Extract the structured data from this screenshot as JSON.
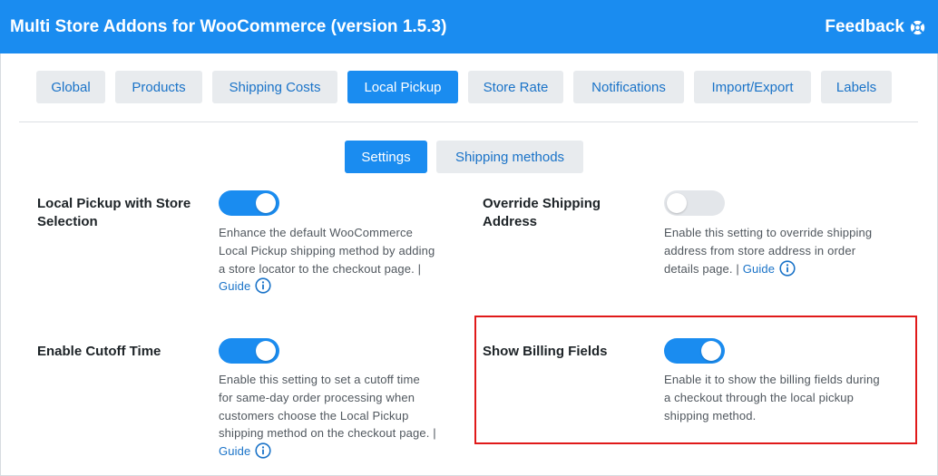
{
  "header": {
    "title": "Multi Store Addons for WooCommerce (version 1.5.3)",
    "feedback_label": "Feedback"
  },
  "tabs": [
    {
      "label": "Global"
    },
    {
      "label": "Products"
    },
    {
      "label": "Shipping Costs"
    },
    {
      "label": "Local Pickup",
      "active": true
    },
    {
      "label": "Store Rate"
    },
    {
      "label": "Notifications"
    },
    {
      "label": "Import/Export"
    },
    {
      "label": "Labels"
    }
  ],
  "subtabs": [
    {
      "label": "Settings",
      "active": true
    },
    {
      "label": "Shipping methods"
    }
  ],
  "settings": {
    "local_pickup_store": {
      "label_line1": "Local Pickup with Store",
      "label_line2": "Selection",
      "enabled": true,
      "desc_line1": "Enhance the default WooCommerce",
      "desc_line2": "Local Pickup shipping method by adding",
      "desc_line3": "a store locator to the checkout page. |",
      "guide": "Guide"
    },
    "override_shipping": {
      "label_line1": "Override Shipping",
      "label_line2": "Address",
      "enabled": false,
      "desc_line1": "Enable this setting to override shipping",
      "desc_line2": "address from store address in order",
      "desc_line3": "details page. |",
      "guide": "Guide"
    },
    "cutoff_time": {
      "label": "Enable Cutoff Time",
      "enabled": true,
      "desc_line1": "Enable this setting to set a cutoff time",
      "desc_line2": "for same-day order processing when",
      "desc_line3": "customers choose the Local Pickup",
      "desc_line4": "shipping method on the checkout page. |",
      "guide": "Guide"
    },
    "billing_fields": {
      "label": "Show Billing Fields",
      "enabled": true,
      "desc_line1": "Enable it to show the billing fields during",
      "desc_line2": "a checkout through the local pickup",
      "desc_line3": "shipping method."
    }
  },
  "colors": {
    "accent": "#1a8cf0",
    "highlight_border": "#e01a1a"
  },
  "icons": {
    "feedback": "lifebuoy-icon",
    "info": "info-circle-icon"
  }
}
